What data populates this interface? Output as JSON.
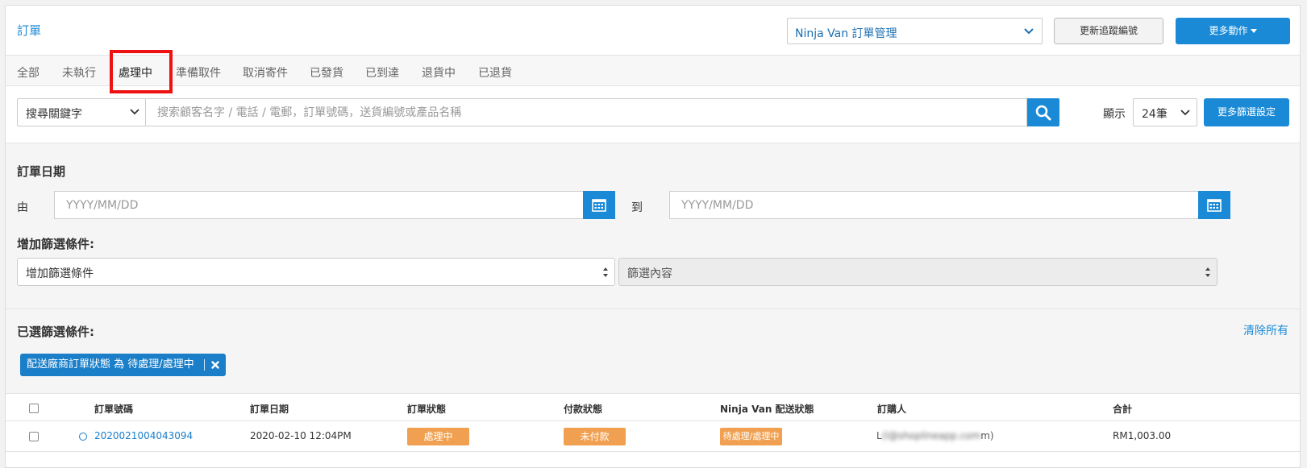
{
  "header": {
    "title": "訂單",
    "channel_select": "Ninja Van 訂單管理",
    "update_tracking_label": "更新追蹤編號",
    "more_actions_label": "更多動作"
  },
  "tabs": [
    {
      "label": "全部"
    },
    {
      "label": "未執行"
    },
    {
      "label": "處理中",
      "active": true
    },
    {
      "label": "準備取件"
    },
    {
      "label": "取消寄件"
    },
    {
      "label": "已發貨"
    },
    {
      "label": "已到達"
    },
    {
      "label": "退貨中"
    },
    {
      "label": "已退貨"
    }
  ],
  "search": {
    "keyword_select": "搜尋關鍵字",
    "placeholder": "搜索顧客名字 / 電話 / 電郵，訂單號碼，送貨編號或產品名稱",
    "show_label": "顯示",
    "show_count": "24筆",
    "more_filters_label": "更多篩選設定"
  },
  "filters": {
    "order_date_title": "訂單日期",
    "from_label": "由",
    "to_label": "到",
    "date_placeholder": "YYYY/MM/DD",
    "add_condition_title": "增加篩選條件:",
    "add_condition_select": "增加篩選條件",
    "filter_content_select": "篩選內容"
  },
  "selected": {
    "title": "已選篩選條件:",
    "clear_all": "清除所有",
    "chip_label": "配送廠商訂單狀態 為 待處理/處理中"
  },
  "table": {
    "headers": [
      "訂單號碼",
      "訂單日期",
      "訂單狀態",
      "付款狀態",
      "Ninja Van 配送狀態",
      "訂購人",
      "合計"
    ],
    "rows": [
      {
        "order_no": "20200210040430​94",
        "date": "2020-02-10 12:04PM",
        "order_status": "處理中",
        "payment_status": "未付款",
        "delivery_status": "待處理/處理中",
        "customer_visible": "L",
        "customer_blurred": "(l@shoplineapp.com",
        "customer_tail": "m)",
        "total": "RM1,003.00"
      }
    ]
  },
  "colors": {
    "primary": "#1a8ad6",
    "highlight": "#ee1111",
    "badge_orange": "#f0a050"
  }
}
